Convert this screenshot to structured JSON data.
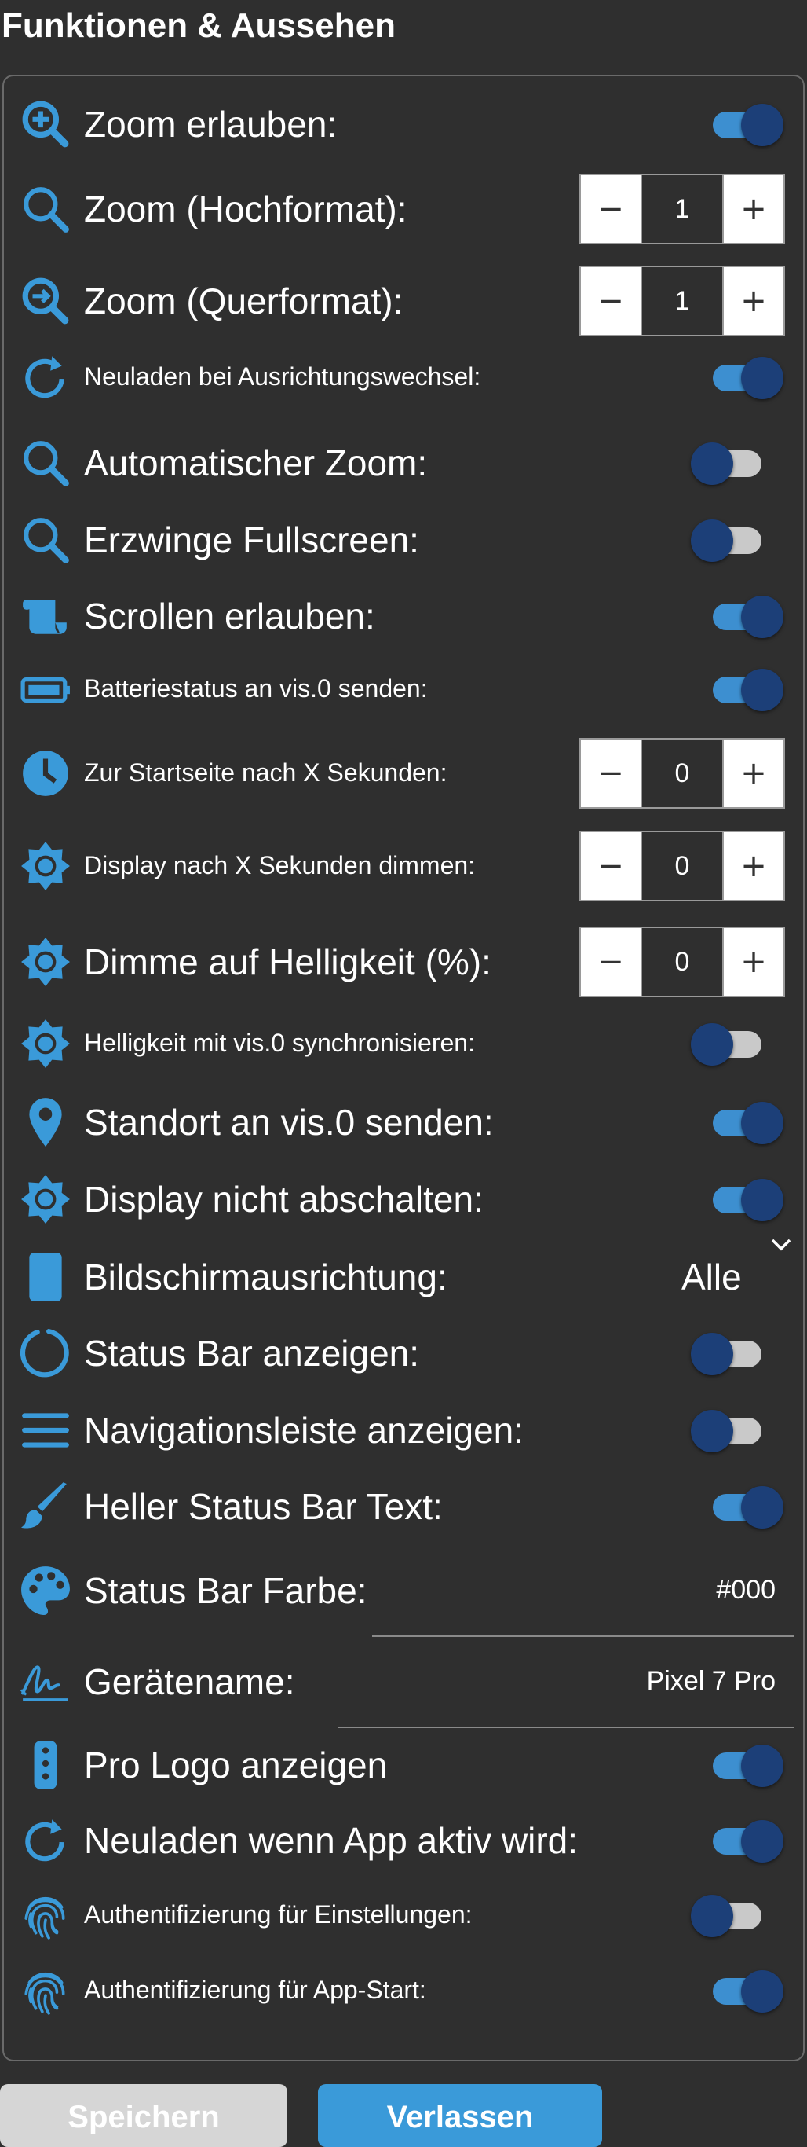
{
  "section": {
    "title": "Funktionen & Aussehen"
  },
  "colors": {
    "accent": "#3a9ad9",
    "toggle_on_track": "#3d8fd0",
    "toggle_knob": "#1c3f78",
    "background": "#2f2f2f"
  },
  "settings": [
    {
      "label": "Zoom erlauben:",
      "icon": "zoom-in-icon",
      "control": "toggle",
      "on": true
    },
    {
      "label": "Zoom (Hochformat):",
      "icon": "search-icon",
      "control": "stepper",
      "value": "1"
    },
    {
      "label": "Zoom (Querformat):",
      "icon": "search-arrow-icon",
      "control": "stepper",
      "value": "1"
    },
    {
      "label": "Neuladen bei Ausrichtungswechsel:",
      "icon": "refresh-icon",
      "control": "toggle",
      "on": true
    },
    {
      "label": "Automatischer Zoom:",
      "icon": "search-icon",
      "control": "toggle",
      "on": false
    },
    {
      "label": "Erzwinge Fullscreen:",
      "icon": "search-icon",
      "control": "toggle",
      "on": false
    },
    {
      "label": "Scrollen erlauben:",
      "icon": "scroll-icon",
      "control": "toggle",
      "on": true
    },
    {
      "label": "Batteriestatus an vis.0 senden:",
      "icon": "battery-icon",
      "control": "toggle",
      "on": true
    },
    {
      "label": "Zur Startseite nach X Sekunden:",
      "icon": "clock-icon",
      "control": "stepper",
      "value": "0"
    },
    {
      "label": "Display nach X Sekunden dimmen:",
      "icon": "brightness-icon",
      "control": "stepper",
      "value": "0"
    },
    {
      "label": "Dimme auf Helligkeit (%):",
      "icon": "brightness-icon",
      "control": "stepper",
      "value": "0"
    },
    {
      "label": "Helligkeit mit vis.0 synchronisieren:",
      "icon": "brightness-icon",
      "control": "toggle",
      "on": false
    },
    {
      "label": "Standort an vis.0 senden:",
      "icon": "location-pin-icon",
      "control": "toggle",
      "on": true
    },
    {
      "label": "Display nicht abschalten:",
      "icon": "brightness-icon",
      "control": "toggle",
      "on": true
    },
    {
      "label": "Bildschirmausrichtung:",
      "icon": "tablet-icon",
      "control": "select",
      "value": "Alle"
    },
    {
      "label": "Status Bar anzeigen:",
      "icon": "circle-notch-icon",
      "control": "toggle",
      "on": false
    },
    {
      "label": "Navigationsleiste anzeigen:",
      "icon": "menu-icon",
      "control": "toggle",
      "on": false
    },
    {
      "label": "Heller Status Bar Text:",
      "icon": "brush-icon",
      "control": "toggle",
      "on": true
    },
    {
      "label": "Status Bar Farbe:",
      "icon": "palette-icon",
      "control": "text",
      "value": "#000"
    },
    {
      "label": "Gerätename:",
      "icon": "signature-icon",
      "control": "text",
      "value": "Pixel 7 Pro"
    },
    {
      "label": "Pro Logo anzeigen",
      "icon": "remote-icon",
      "control": "toggle",
      "on": true
    },
    {
      "label": "Neuladen wenn App aktiv wird:",
      "icon": "refresh-icon",
      "control": "toggle",
      "on": true
    },
    {
      "label": "Authentifizierung für Einstellungen:",
      "icon": "fingerprint-icon",
      "control": "toggle",
      "on": false
    },
    {
      "label": "Authentifizierung für App-Start:",
      "icon": "fingerprint-icon",
      "control": "toggle",
      "on": true
    }
  ],
  "stepper": {
    "minus": "−",
    "plus": "+"
  },
  "buttons": {
    "save": "Speichern",
    "reset": "Verlassen"
  }
}
